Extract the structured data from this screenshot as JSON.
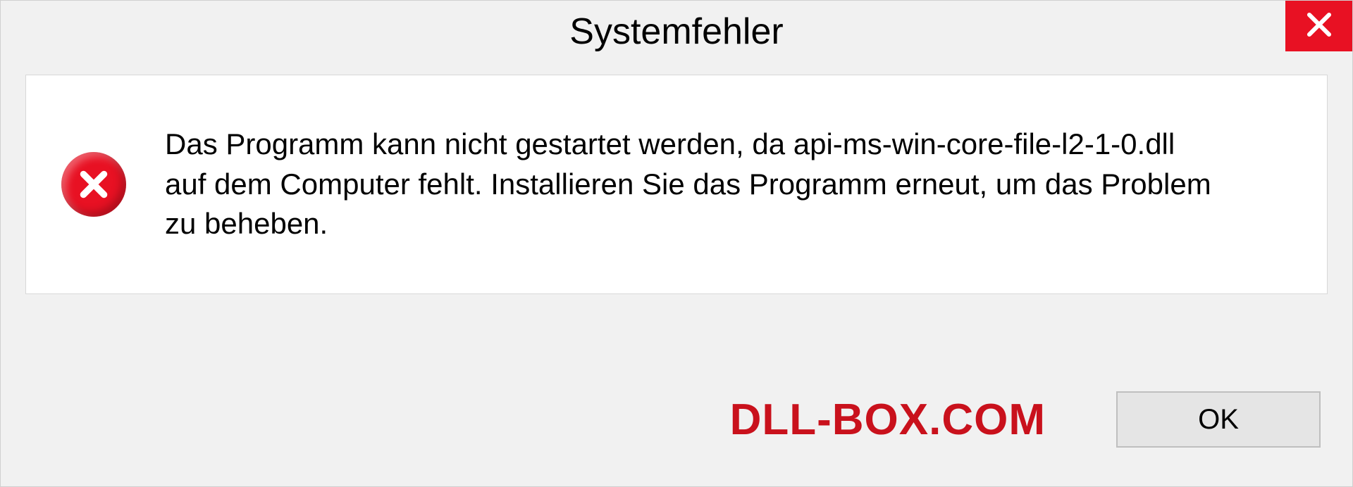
{
  "dialog": {
    "title": "Systemfehler",
    "message": "Das Programm kann nicht gestartet werden, da api-ms-win-core-file-l2-1-0.dll auf dem Computer fehlt. Installieren Sie das Programm erneut, um das Problem zu beheben.",
    "ok_label": "OK"
  },
  "watermark": "DLL-BOX.COM"
}
